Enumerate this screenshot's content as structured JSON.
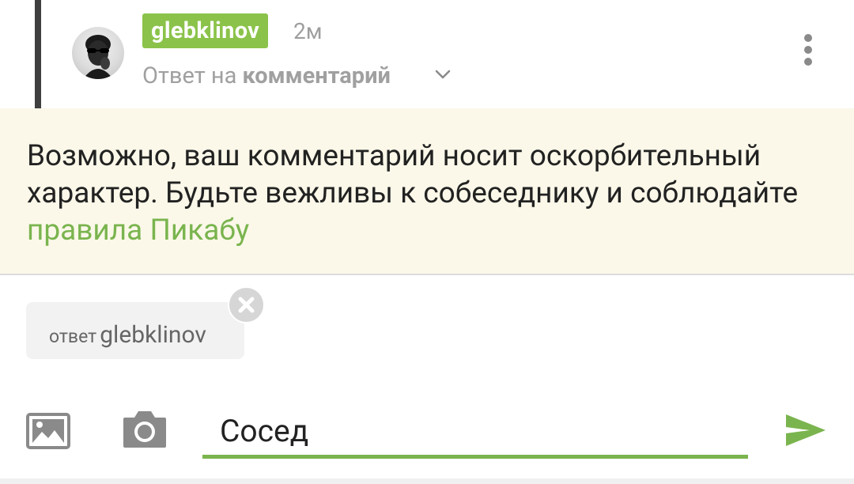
{
  "comment": {
    "username": "glebklinov",
    "time": "2м",
    "reply_prefix": "Ответ на",
    "reply_target": "комментарий"
  },
  "warning": {
    "text": "Возможно, ваш комментарий носит оскорбительный характер. Будьте вежливы к собеседнику и соблюдайте",
    "link_text": "правила Пикабу"
  },
  "reply_chip": {
    "prefix": "ответ",
    "name": "glebklinov"
  },
  "composer": {
    "input_value": "Сосед"
  },
  "colors": {
    "accent_green": "#8bc34a",
    "link_green": "#7ab44e",
    "warning_bg": "#fbf8e9"
  },
  "icons": [
    "avatar",
    "chevron-down-icon",
    "more-vertical-icon",
    "close-icon",
    "image-icon",
    "camera-icon",
    "send-icon"
  ]
}
